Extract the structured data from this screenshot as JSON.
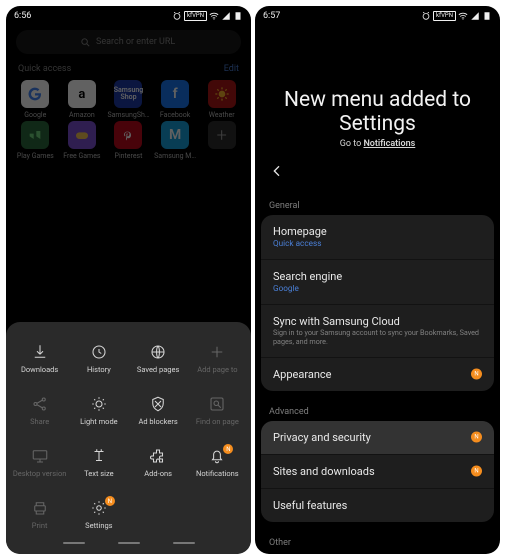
{
  "left": {
    "status": {
      "time": "6:56",
      "vpn": "kfVPN"
    },
    "search": {
      "placeholder": "Search or enter URL"
    },
    "quick_access": {
      "title": "Quick access",
      "edit": "Edit",
      "items": [
        {
          "label": "Google"
        },
        {
          "label": "Amazon"
        },
        {
          "label": "SamsungSh…"
        },
        {
          "label": "Facebook"
        },
        {
          "label": "Weather"
        },
        {
          "label": "Play Games"
        },
        {
          "label": "Free Games"
        },
        {
          "label": "Pinterest"
        },
        {
          "label": "Samsung M…"
        }
      ]
    },
    "sheet": {
      "items": [
        {
          "label": "Downloads",
          "icon": "download"
        },
        {
          "label": "History",
          "icon": "history"
        },
        {
          "label": "Saved pages",
          "icon": "saved"
        },
        {
          "label": "Add page to",
          "icon": "plus",
          "disabled": true
        },
        {
          "label": "Share",
          "icon": "share",
          "disabled": true
        },
        {
          "label": "Light mode",
          "icon": "sun"
        },
        {
          "label": "Ad blockers",
          "icon": "shield"
        },
        {
          "label": "Find on page",
          "icon": "find",
          "disabled": true
        },
        {
          "label": "Desktop version",
          "icon": "desktop",
          "disabled": true
        },
        {
          "label": "Text size",
          "icon": "textsize"
        },
        {
          "label": "Add-ons",
          "icon": "addons"
        },
        {
          "label": "Notifications",
          "icon": "bell",
          "badge": "N"
        },
        {
          "label": "Print",
          "icon": "print",
          "disabled": true
        },
        {
          "label": "Settings",
          "icon": "settings",
          "badge": "N"
        }
      ]
    }
  },
  "right": {
    "status": {
      "time": "6:57",
      "vpn": "kfVPN"
    },
    "headline": {
      "title_l1": "New menu added to",
      "title_l2": "Settings",
      "sub_pre": "Go to ",
      "sub_link": "Notifications"
    },
    "sections": {
      "general": {
        "label": "General",
        "rows": [
          {
            "title": "Homepage",
            "secondary": "Quick access"
          },
          {
            "title": "Search engine",
            "secondary": "Google"
          },
          {
            "title": "Sync with Samsung Cloud",
            "desc": "Sign in to your Samsung account to sync your Bookmarks, Saved pages, and more."
          },
          {
            "title": "Appearance",
            "badge": "N"
          }
        ]
      },
      "advanced": {
        "label": "Advanced",
        "rows": [
          {
            "title": "Privacy and security",
            "badge": "N",
            "highlight": true
          },
          {
            "title": "Sites and downloads",
            "badge": "N"
          },
          {
            "title": "Useful features"
          }
        ]
      },
      "other": {
        "label": "Other"
      }
    }
  },
  "colors": {
    "accent": "#f58d1e",
    "link": "#4a7fd6"
  }
}
